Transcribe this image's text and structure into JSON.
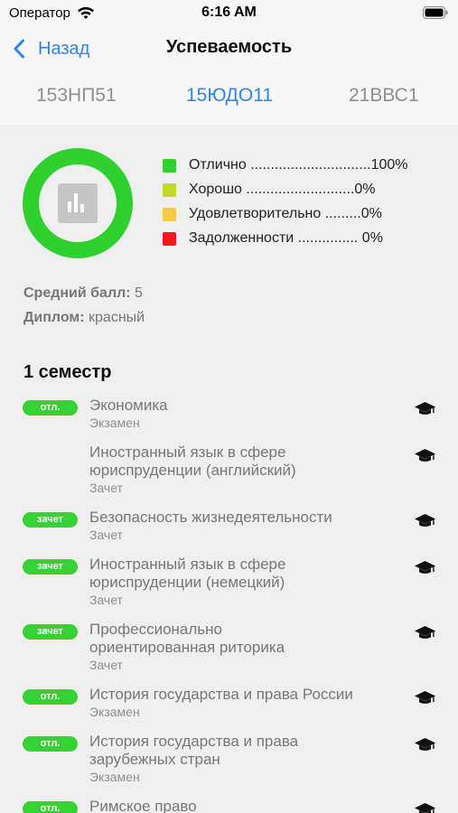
{
  "status_bar": {
    "carrier": "Оператор",
    "time": "6:16 AM"
  },
  "nav": {
    "back_label": "Назад",
    "title": "Успеваемость"
  },
  "tabs": [
    {
      "label": "153НП51",
      "active": false
    },
    {
      "label": "15ЮДО11",
      "active": true
    },
    {
      "label": "21ВВС1",
      "active": false
    }
  ],
  "chart_data": {
    "type": "pie",
    "categories": [
      "Отлично",
      "Хорошо",
      "Удовлетворительно",
      "Задолженности"
    ],
    "values": [
      100,
      0,
      0,
      0
    ],
    "colors": [
      "#2fd12f",
      "#c3d82b",
      "#f9c94c",
      "#f21b1b"
    ]
  },
  "legend": [
    {
      "label": "Отлично ..............................100%",
      "color": "#2fd12f"
    },
    {
      "label": "Хорошо ...........................0%",
      "color": "#c3d82b"
    },
    {
      "label": "Удовлетворительно .........0%",
      "color": "#f9c94c"
    },
    {
      "label": "Задолженности ............... 0%",
      "color": "#f21b1b"
    }
  ],
  "summary": {
    "average_label": "Средний балл:",
    "average_value": " 5",
    "diploma_label": "Диплом:",
    "diploma_value": " красный"
  },
  "semester": {
    "title": "1 семестр",
    "subjects": [
      {
        "badge": "отл.",
        "lines": [
          "Экономика"
        ],
        "type": "Экзамен"
      },
      {
        "badge": "",
        "lines": [
          "Иностранный язык в сфере",
          "юриспруденции (английский)"
        ],
        "type": "Зачет"
      },
      {
        "badge": "зачет",
        "lines": [
          "Безопасность жизнедеятельности"
        ],
        "type": "Зачет"
      },
      {
        "badge": "зачет",
        "lines": [
          "Иностранный язык в сфере",
          "юриспруденции (немецкий)"
        ],
        "type": "Зачет"
      },
      {
        "badge": "зачет",
        "lines": [
          "Профессионально",
          "ориентированная риторика"
        ],
        "type": "Зачет"
      },
      {
        "badge": "отл.",
        "lines": [
          "История государства и права России"
        ],
        "type": "Экзамен"
      },
      {
        "badge": "отл.",
        "lines": [
          "История государства и права",
          "зарубежных стран"
        ],
        "type": "Экзамен"
      },
      {
        "badge": "отл.",
        "lines": [
          "Римское право"
        ],
        "type": ""
      }
    ]
  },
  "icons": {
    "wifi": "wifi-icon",
    "battery": "battery-icon",
    "back": "chevron-left-icon",
    "chart_center": "bar-chart-icon",
    "subject": "graduation-cap-icon"
  }
}
